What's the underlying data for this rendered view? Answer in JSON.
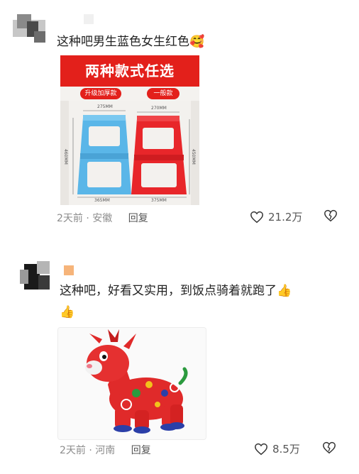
{
  "comments": [
    {
      "text": "这种吧男生蓝色女生红色",
      "text_emoji": "🥰",
      "image": {
        "banner": "两种款式任选",
        "tag_left": "升级加厚款",
        "tag_right": "一般款",
        "dim_top_left": "275MM",
        "dim_top_right": "270MM",
        "dim_side_left": "460MM",
        "dim_side_right": "450MM",
        "dim_bottom_left": "365MM",
        "dim_bottom_right": "375MM"
      },
      "time": "2天前",
      "location": "安徽",
      "reply_label": "回复",
      "likes": "21.2万"
    },
    {
      "text": "这种吧，好看又实用，到饭点骑着就跑了",
      "text_emoji": "👍",
      "text_emoji_2": "👍",
      "time": "2天前",
      "location": "河南",
      "reply_label": "回复",
      "likes": "8.5万"
    }
  ],
  "colors": {
    "accent_red": "#e3201b",
    "stool_blue": "#5ab6e8",
    "stool_red": "#e8262a",
    "meta_gray": "#8c8c8c"
  },
  "icons": [
    "heart-outline-icon",
    "broken-heart-icon",
    "thumbs-up-icon"
  ]
}
